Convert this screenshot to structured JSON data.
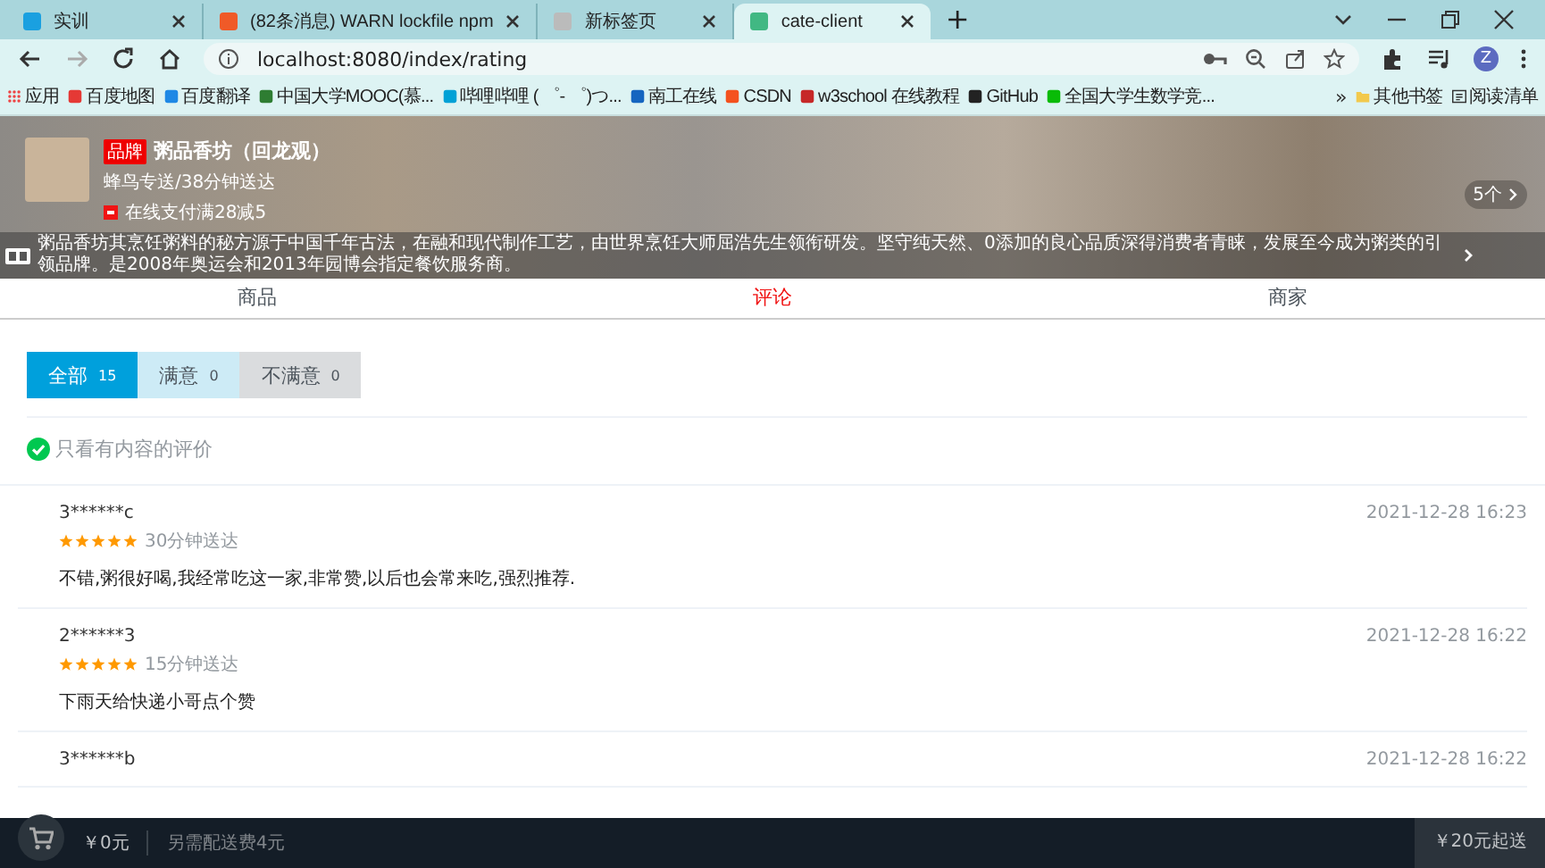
{
  "browser": {
    "tabs": [
      {
        "title": "实训",
        "selected": false
      },
      {
        "title": "(82条消息) WARN lockfile npm",
        "selected": false
      },
      {
        "title": "新标签页",
        "selected": false
      },
      {
        "title": "cate-client",
        "selected": true
      }
    ],
    "new_tab": "+",
    "address": "localhost:8080/index/rating",
    "profile": "Z",
    "bookmarks": [
      "应用",
      "百度地图",
      "百度翻译",
      "中国大学MOOC(慕...",
      "哔哩哔哩 ( ゜- ゜)つ...",
      "南工在线",
      "CSDN",
      "w3school 在线教程",
      "GitHub",
      "全国大学生数学竞..."
    ],
    "more_bookmarks": "»",
    "bookmarks_right": [
      "其他书签",
      "阅读清单"
    ]
  },
  "seller": {
    "brand": "品牌",
    "name": "粥品香坊（回龙观）",
    "delivery": "蜂鸟专送/38分钟送达",
    "support": "在线支付满28减5",
    "support_count": "5个",
    "bulletin": "粥品香坊其烹饪粥料的秘方源于中国千年古法，在融和现代制作工艺，由世界烹饪大师屈浩先生领衔研发。坚守纯天然、0添加的良心品质深得消费者青睐，发展至今成为粥类的引领品牌。是2008年奥运会和2013年园博会指定餐饮服务商。"
  },
  "nav": [
    {
      "label": "商品",
      "selected": false
    },
    {
      "label": "评论",
      "selected": true
    },
    {
      "label": "商家",
      "selected": false
    }
  ],
  "filters": [
    {
      "label": "全部",
      "count": "15",
      "kind": "all",
      "selected": true
    },
    {
      "label": "满意",
      "count": "0",
      "kind": "positive",
      "selected": false
    },
    {
      "label": "不满意",
      "count": "0",
      "kind": "negative",
      "selected": false
    }
  ],
  "only_content": {
    "label": "只看有内容的评价",
    "checked": true
  },
  "reviews": [
    {
      "user": "3******c",
      "stars": 5,
      "delivery": "30分钟送达",
      "text": "不错,粥很好喝,我经常吃这一家,非常赞,以后也会常来吃,强烈推荐.",
      "time": "2021-12-28 16:23"
    },
    {
      "user": "2******3",
      "stars": 5,
      "delivery": "15分钟送达",
      "text": "下雨天给快递小哥点个赞",
      "time": "2021-12-28 16:22"
    },
    {
      "user": "3******b",
      "time": "2021-12-28 16:22"
    }
  ],
  "cart": {
    "price": "￥0元",
    "delivery_fee": "另需配送费4元",
    "min_price": "￥20元起送"
  }
}
